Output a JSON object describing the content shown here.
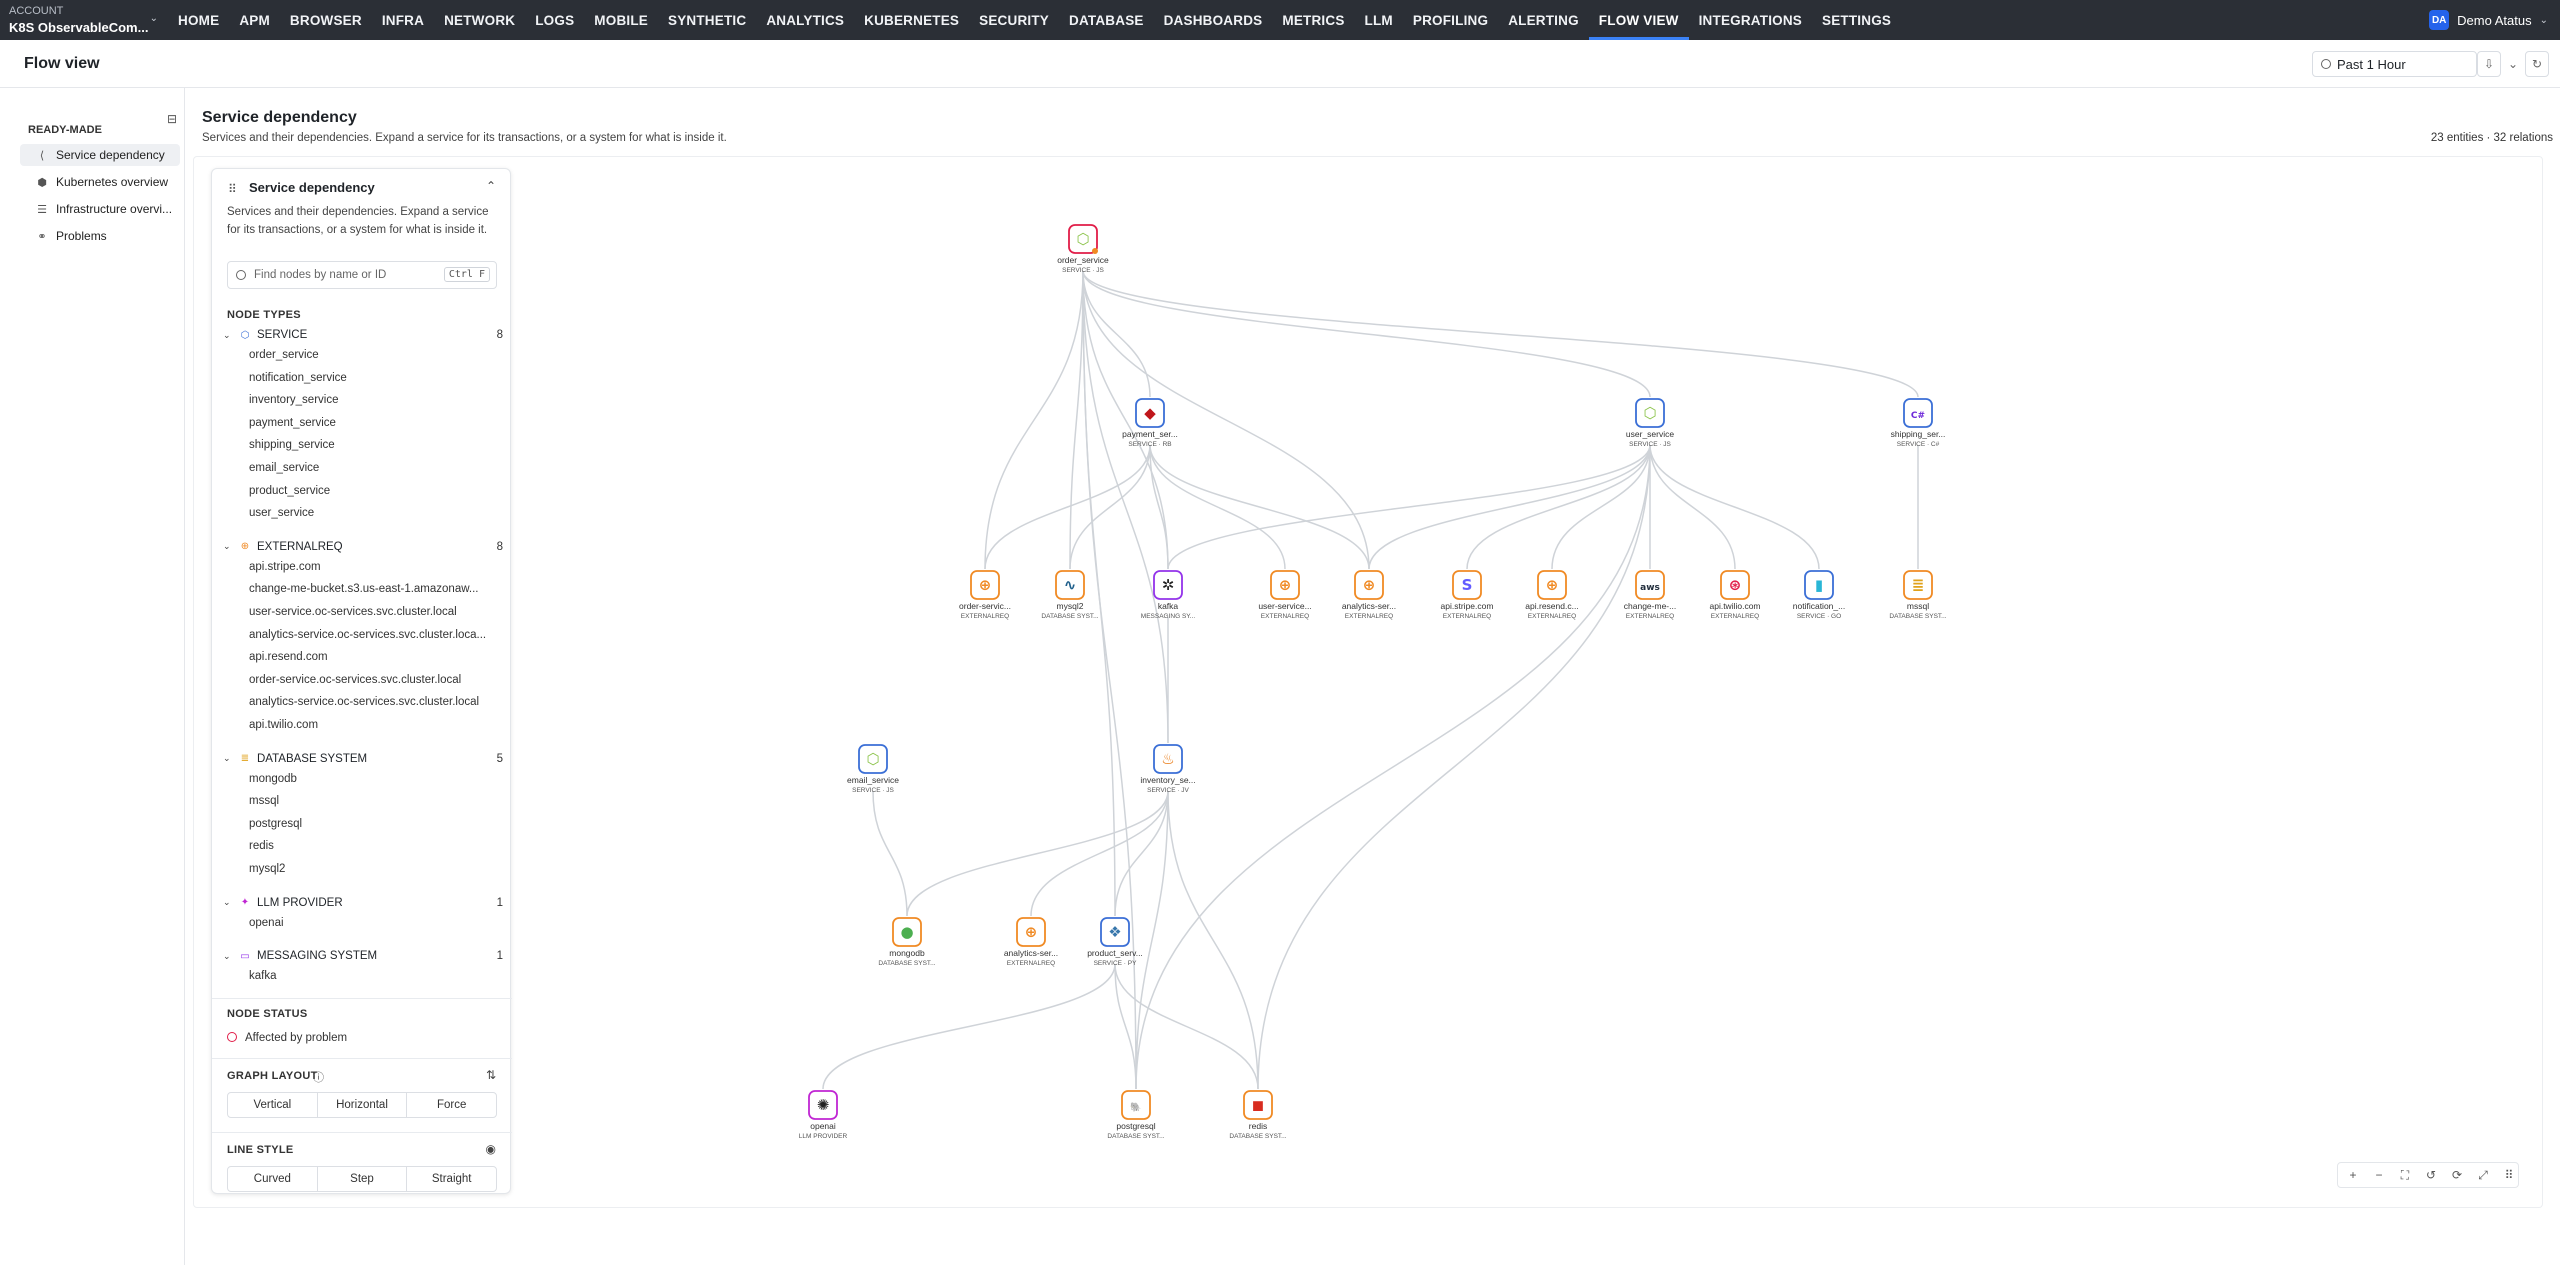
{
  "account": {
    "label": "ACCOUNT",
    "name": "K8S ObservableCom..."
  },
  "nav": [
    {
      "label": "HOME"
    },
    {
      "label": "APM"
    },
    {
      "label": "BROWSER"
    },
    {
      "label": "INFRA"
    },
    {
      "label": "NETWORK"
    },
    {
      "label": "LOGS"
    },
    {
      "label": "MOBILE"
    },
    {
      "label": "SYNTHETIC"
    },
    {
      "label": "ANALYTICS"
    },
    {
      "label": "KUBERNETES"
    },
    {
      "label": "SECURITY"
    },
    {
      "label": "DATABASE"
    },
    {
      "label": "DASHBOARDS"
    },
    {
      "label": "METRICS"
    },
    {
      "label": "LLM"
    },
    {
      "label": "PROFILING"
    },
    {
      "label": "ALERTING"
    },
    {
      "label": "FLOW VIEW",
      "active": true
    },
    {
      "label": "INTEGRATIONS"
    },
    {
      "label": "SETTINGS"
    }
  ],
  "user": {
    "initials": "DA",
    "name": "Demo Atatus"
  },
  "page": {
    "title": "Flow view",
    "time_range": "Past 1 Hour"
  },
  "sidebar": {
    "section": "READY-MADE",
    "items": [
      {
        "label": "Service dependency",
        "icon": "share-icon",
        "active": true
      },
      {
        "label": "Kubernetes overview",
        "icon": "cube-icon"
      },
      {
        "label": "Infrastructure overvi...",
        "icon": "server-icon"
      },
      {
        "label": "Problems",
        "icon": "network-icon"
      }
    ]
  },
  "content": {
    "title": "Service dependency",
    "subtitle": "Services and their dependencies. Expand a service for its transactions, or a system for what is inside it.",
    "counts": "23 entities · 32 relations"
  },
  "panel": {
    "title": "Service dependency",
    "description": "Services and their dependencies. Expand a service for its transactions, or a system for what is inside it.",
    "search_placeholder": "Find nodes by name or ID",
    "search_shortcut": "Ctrl F",
    "node_types_label": "NODE TYPES",
    "groups": [
      {
        "name": "SERVICE",
        "count": "8",
        "color": "#3b6fd6",
        "items": [
          "order_service",
          "notification_service",
          "inventory_service",
          "payment_service",
          "shipping_service",
          "email_service",
          "product_service",
          "user_service"
        ]
      },
      {
        "name": "EXTERNALREQ",
        "count": "8",
        "color": "#f08a24",
        "items": [
          "api.stripe.com",
          "change-me-bucket.s3.us-east-1.amazonaw...",
          "user-service.oc-services.svc.cluster.local",
          "analytics-service.oc-services.svc.cluster.loca...",
          "api.resend.com",
          "order-service.oc-services.svc.cluster.local",
          "analytics-service.oc-services.svc.cluster.local",
          "api.twilio.com"
        ]
      },
      {
        "name": "DATABASE SYSTEM",
        "count": "5",
        "color": "#e0a21a",
        "items": [
          "mongodb",
          "mssql",
          "postgresql",
          "redis",
          "mysql2"
        ]
      },
      {
        "name": "LLM PROVIDER",
        "count": "1",
        "color": "#c026d3",
        "items": [
          "openai"
        ]
      },
      {
        "name": "MESSAGING SYSTEM",
        "count": "1",
        "color": "#9333ea",
        "items": [
          "kafka"
        ]
      }
    ],
    "node_status_label": "NODE STATUS",
    "status_item": "Affected by problem",
    "layout_label": "GRAPH LAYOUT",
    "layout_options": [
      "Vertical",
      "Horizontal",
      "Force"
    ],
    "line_label": "LINE STYLE",
    "line_options": [
      "Curved",
      "Step",
      "Straight"
    ]
  },
  "nodes": [
    {
      "id": "order",
      "name": "order_service",
      "sub": "SERVICE · JS",
      "color": "#e11d48",
      "glyph": "⬡",
      "glyphColor": "#8bc34a"
    },
    {
      "id": "payment",
      "name": "payment_ser...",
      "sub": "SERVICE · RB",
      "color": "#3b6fd6",
      "glyph": "◆",
      "glyphColor": "#c0161b"
    },
    {
      "id": "user",
      "name": "user_service",
      "sub": "SERVICE · JS",
      "color": "#3b6fd6",
      "glyph": "⬡",
      "glyphColor": "#8bc34a"
    },
    {
      "id": "shipping",
      "name": "shipping_ser...",
      "sub": "SERVICE · C#",
      "color": "#3b6fd6",
      "glyph": "C#",
      "glyphColor": "#6d28d9"
    },
    {
      "id": "ordersvc",
      "name": "order-servic...",
      "sub": "EXTERNALREQ",
      "color": "#f08a24",
      "glyph": "⊕",
      "glyphColor": "#f08a24"
    },
    {
      "id": "mysql2",
      "name": "mysql2",
      "sub": "DATABASE SYST...",
      "color": "#f08a24",
      "glyph": "∿",
      "glyphColor": "#1f5f8b"
    },
    {
      "id": "kafka",
      "name": "kafka",
      "sub": "MESSAGING SY...",
      "color": "#9333ea",
      "glyph": "✲",
      "glyphColor": "#222"
    },
    {
      "id": "usersvc",
      "name": "user-service...",
      "sub": "EXTERNALREQ",
      "color": "#f08a24",
      "glyph": "⊕",
      "glyphColor": "#f08a24"
    },
    {
      "id": "analytics1",
      "name": "analytics-ser...",
      "sub": "EXTERNALREQ",
      "color": "#f08a24",
      "glyph": "⊕",
      "glyphColor": "#f08a24"
    },
    {
      "id": "stripe",
      "name": "api.stripe.com",
      "sub": "EXTERNALREQ",
      "color": "#f08a24",
      "glyph": "S",
      "glyphColor": "#635bff"
    },
    {
      "id": "resend",
      "name": "api.resend.c...",
      "sub": "EXTERNALREQ",
      "color": "#f08a24",
      "glyph": "⊕",
      "glyphColor": "#f08a24"
    },
    {
      "id": "changeme",
      "name": "change-me-...",
      "sub": "EXTERNALREQ",
      "color": "#f08a24",
      "glyph": "aws",
      "glyphColor": "#232f3e"
    },
    {
      "id": "twilio",
      "name": "api.twilio.com",
      "sub": "EXTERNALREQ",
      "color": "#f08a24",
      "glyph": "⊛",
      "glyphColor": "#e11d48"
    },
    {
      "id": "notification",
      "name": "notification_...",
      "sub": "SERVICE · GO",
      "color": "#3b6fd6",
      "glyph": "▮",
      "glyphColor": "#29b6d6"
    },
    {
      "id": "mssql",
      "name": "mssql",
      "sub": "DATABASE SYST...",
      "color": "#f08a24",
      "glyph": "≣",
      "glyphColor": "#e0a21a"
    },
    {
      "id": "email",
      "name": "email_service",
      "sub": "SERVICE · JS",
      "color": "#3b6fd6",
      "glyph": "⬡",
      "glyphColor": "#8bc34a"
    },
    {
      "id": "inventory",
      "name": "inventory_se...",
      "sub": "SERVICE · JV",
      "color": "#3b6fd6",
      "glyph": "♨",
      "glyphColor": "#e76f00"
    },
    {
      "id": "mongodb",
      "name": "mongodb",
      "sub": "DATABASE SYST...",
      "color": "#f08a24",
      "glyph": "●",
      "glyphColor": "#4caf50"
    },
    {
      "id": "analytics2",
      "name": "analytics-ser...",
      "sub": "EXTERNALREQ",
      "color": "#f08a24",
      "glyph": "⊕",
      "glyphColor": "#f08a24"
    },
    {
      "id": "product",
      "name": "product_serv...",
      "sub": "SERVICE · PY",
      "color": "#3b6fd6",
      "glyph": "❖",
      "glyphColor": "#3776ab"
    },
    {
      "id": "openai",
      "name": "openai",
      "sub": "LLM PROVIDER",
      "color": "#c026d3",
      "glyph": "✺",
      "glyphColor": "#222"
    },
    {
      "id": "postgresql",
      "name": "postgresql",
      "sub": "DATABASE SYST...",
      "color": "#f08a24",
      "glyph": "🐘",
      "glyphColor": "#336791"
    },
    {
      "id": "redis",
      "name": "redis",
      "sub": "DATABASE SYST...",
      "color": "#f08a24",
      "glyph": "◼",
      "glyphColor": "#d82c20"
    }
  ],
  "edges": [
    [
      "order",
      "payment"
    ],
    [
      "order",
      "user"
    ],
    [
      "order",
      "shipping"
    ],
    [
      "order",
      "kafka"
    ],
    [
      "order",
      "ordersvc"
    ],
    [
      "order",
      "mysql2"
    ],
    [
      "order",
      "product"
    ],
    [
      "order",
      "postgresql"
    ],
    [
      "order",
      "analytics1"
    ],
    [
      "order",
      "inventory"
    ],
    [
      "payment",
      "ordersvc"
    ],
    [
      "payment",
      "mysql2"
    ],
    [
      "payment",
      "kafka"
    ],
    [
      "payment",
      "usersvc"
    ],
    [
      "payment",
      "analytics1"
    ],
    [
      "user",
      "kafka"
    ],
    [
      "user",
      "analytics1"
    ],
    [
      "user",
      "stripe"
    ],
    [
      "user",
      "resend"
    ],
    [
      "user",
      "changeme"
    ],
    [
      "user",
      "twilio"
    ],
    [
      "user",
      "notification"
    ],
    [
      "user",
      "postgresql"
    ],
    [
      "user",
      "redis"
    ],
    [
      "shipping",
      "mssql"
    ],
    [
      "kafka",
      "inventory"
    ],
    [
      "email",
      "mongodb"
    ],
    [
      "inventory",
      "mongodb"
    ],
    [
      "inventory",
      "analytics2"
    ],
    [
      "inventory",
      "product"
    ],
    [
      "inventory",
      "postgresql"
    ],
    [
      "inventory",
      "redis"
    ],
    [
      "product",
      "openai"
    ],
    [
      "product",
      "postgresql"
    ],
    [
      "product",
      "redis"
    ]
  ],
  "controls": [
    "zoom-in-icon",
    "zoom-out-icon",
    "fit-icon",
    "undo-icon",
    "refresh-icon",
    "expand-icon",
    "grid-icon"
  ]
}
